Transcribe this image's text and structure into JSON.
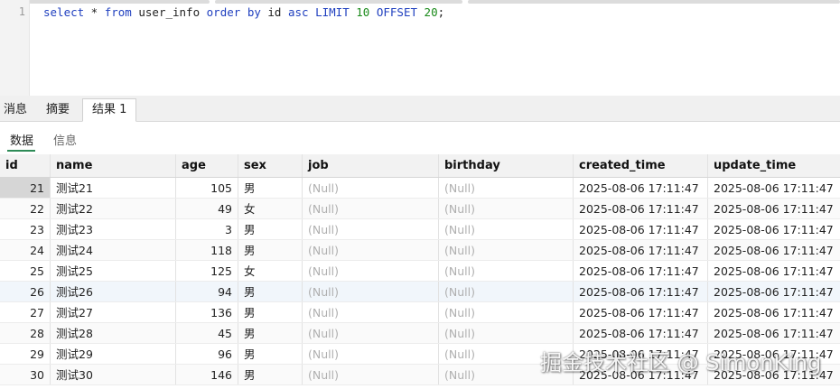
{
  "editor": {
    "line_number": "1",
    "sql_parts": {
      "kw_select": "select",
      "star": " * ",
      "kw_from": "from",
      "table": " user_info ",
      "kw_order": "order",
      "sp1": " ",
      "kw_by": "by",
      "col": " id ",
      "kw_asc": "asc",
      "sp2": " ",
      "kw_limit": "LIMIT",
      "sp3": " ",
      "limit_val": "10",
      "sp4": " ",
      "kw_offset": "OFFSET",
      "sp5": " ",
      "offset_val": "20",
      "semi": ";"
    }
  },
  "bottom_tabs": [
    "消息",
    "摘要",
    "结果 1"
  ],
  "sub_tabs": [
    "数据",
    "信息"
  ],
  "columns": [
    "id",
    "name",
    "age",
    "sex",
    "job",
    "birthday",
    "created_time",
    "update_time"
  ],
  "rows": [
    [
      "21",
      "测试21",
      "105",
      "男",
      "(Null)",
      "(Null)",
      "2025-08-06 17:11:47",
      "2025-08-06 17:11:47"
    ],
    [
      "22",
      "测试22",
      "49",
      "女",
      "(Null)",
      "(Null)",
      "2025-08-06 17:11:47",
      "2025-08-06 17:11:47"
    ],
    [
      "23",
      "测试23",
      "3",
      "男",
      "(Null)",
      "(Null)",
      "2025-08-06 17:11:47",
      "2025-08-06 17:11:47"
    ],
    [
      "24",
      "测试24",
      "118",
      "男",
      "(Null)",
      "(Null)",
      "2025-08-06 17:11:47",
      "2025-08-06 17:11:47"
    ],
    [
      "25",
      "测试25",
      "125",
      "女",
      "(Null)",
      "(Null)",
      "2025-08-06 17:11:47",
      "2025-08-06 17:11:47"
    ],
    [
      "26",
      "测试26",
      "94",
      "男",
      "(Null)",
      "(Null)",
      "2025-08-06 17:11:47",
      "2025-08-06 17:11:47"
    ],
    [
      "27",
      "测试27",
      "136",
      "男",
      "(Null)",
      "(Null)",
      "2025-08-06 17:11:47",
      "2025-08-06 17:11:47"
    ],
    [
      "28",
      "测试28",
      "45",
      "男",
      "(Null)",
      "(Null)",
      "2025-08-06 17:11:47",
      "2025-08-06 17:11:47"
    ],
    [
      "29",
      "测试29",
      "96",
      "男",
      "(Null)",
      "(Null)",
      "2025-08-06 17:11:47",
      "2025-08-06 17:11:47"
    ],
    [
      "30",
      "测试30",
      "146",
      "男",
      "(Null)",
      "(Null)",
      "2025-08-06 17:11:47",
      "2025-08-06 17:11:47"
    ]
  ],
  "watermark": "掘金技术社区 @ SimonKing"
}
